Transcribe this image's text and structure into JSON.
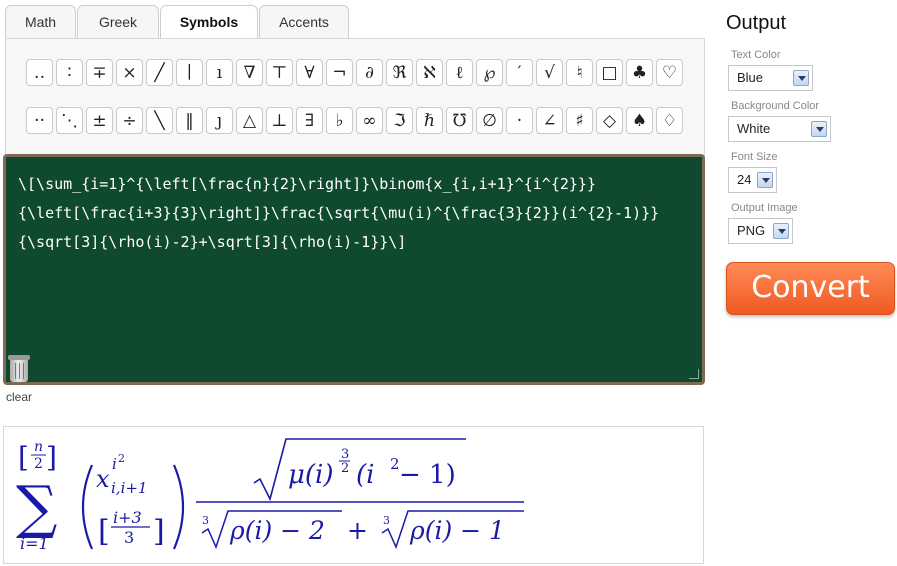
{
  "tabs": [
    {
      "label": "Math"
    },
    {
      "label": "Greek"
    },
    {
      "label": "Symbols"
    },
    {
      "label": "Accents"
    }
  ],
  "symbols": {
    "row1": [
      "‥",
      "∶",
      "∓",
      "×",
      "╱",
      "∣",
      "ı",
      "∇",
      "⊤",
      "∀",
      "¬",
      "∂",
      "ℜ",
      "ℵ",
      "ℓ",
      "℘",
      "′",
      "√",
      "♮",
      "□",
      "♣",
      "♡"
    ],
    "row2": [
      "··",
      "⋱",
      "±",
      "÷",
      "╲",
      "‖",
      "ȷ",
      "△",
      "⊥",
      "∃",
      "♭",
      "∞",
      "ℑ",
      "ℏ",
      "℧",
      "∅",
      "·",
      "∠",
      "♯",
      "◇",
      "♠",
      "♢"
    ]
  },
  "editor": {
    "content": "\\[\\sum_{i=1}^{\\left[\\frac{n}{2}\\right]}\\binom{x_{i,i+1}^{i^{2}}}{\\left[\\frac{i+3}{3}\\right]}\\frac{\\sqrt{\\mu(i)^{\\frac{3}{2}}(i^{2}-1)}}{\\sqrt[3]{\\rho(i)-2}+\\sqrt[3]{\\rho(i)-1}}\\]"
  },
  "clear": {
    "label": "clear"
  },
  "output": {
    "title": "Output",
    "text_color": {
      "label": "Text Color",
      "value": "Blue"
    },
    "background_color": {
      "label": "Background Color",
      "value": "White"
    },
    "font_size": {
      "label": "Font Size",
      "value": "24"
    },
    "output_image": {
      "label": "Output Image",
      "value": "PNG"
    },
    "convert_label": "Convert"
  },
  "formula": {
    "color": "#1a1aa6",
    "sum_sign": "∑",
    "upper_n": "n",
    "upper_2": "2",
    "lower": "i=1",
    "binom_top_base": "x",
    "binom_top_sup": "i",
    "binom_top_sup_sup": "2",
    "binom_top_sub": "i,i+1",
    "binom_bottom_num": "i+3",
    "binom_bottom_den": "3",
    "numerator": "μ(i)",
    "num_exp_num": "3",
    "num_exp_den": "2",
    "num_rest": "(i",
    "num_rest_sup": "2",
    "num_rest_end": " − 1)",
    "den_index1": "3",
    "den_root1": "ρ(i) − 2",
    "den_plus": "+",
    "den_index2": "3",
    "den_root2": "ρ(i) − 1"
  }
}
